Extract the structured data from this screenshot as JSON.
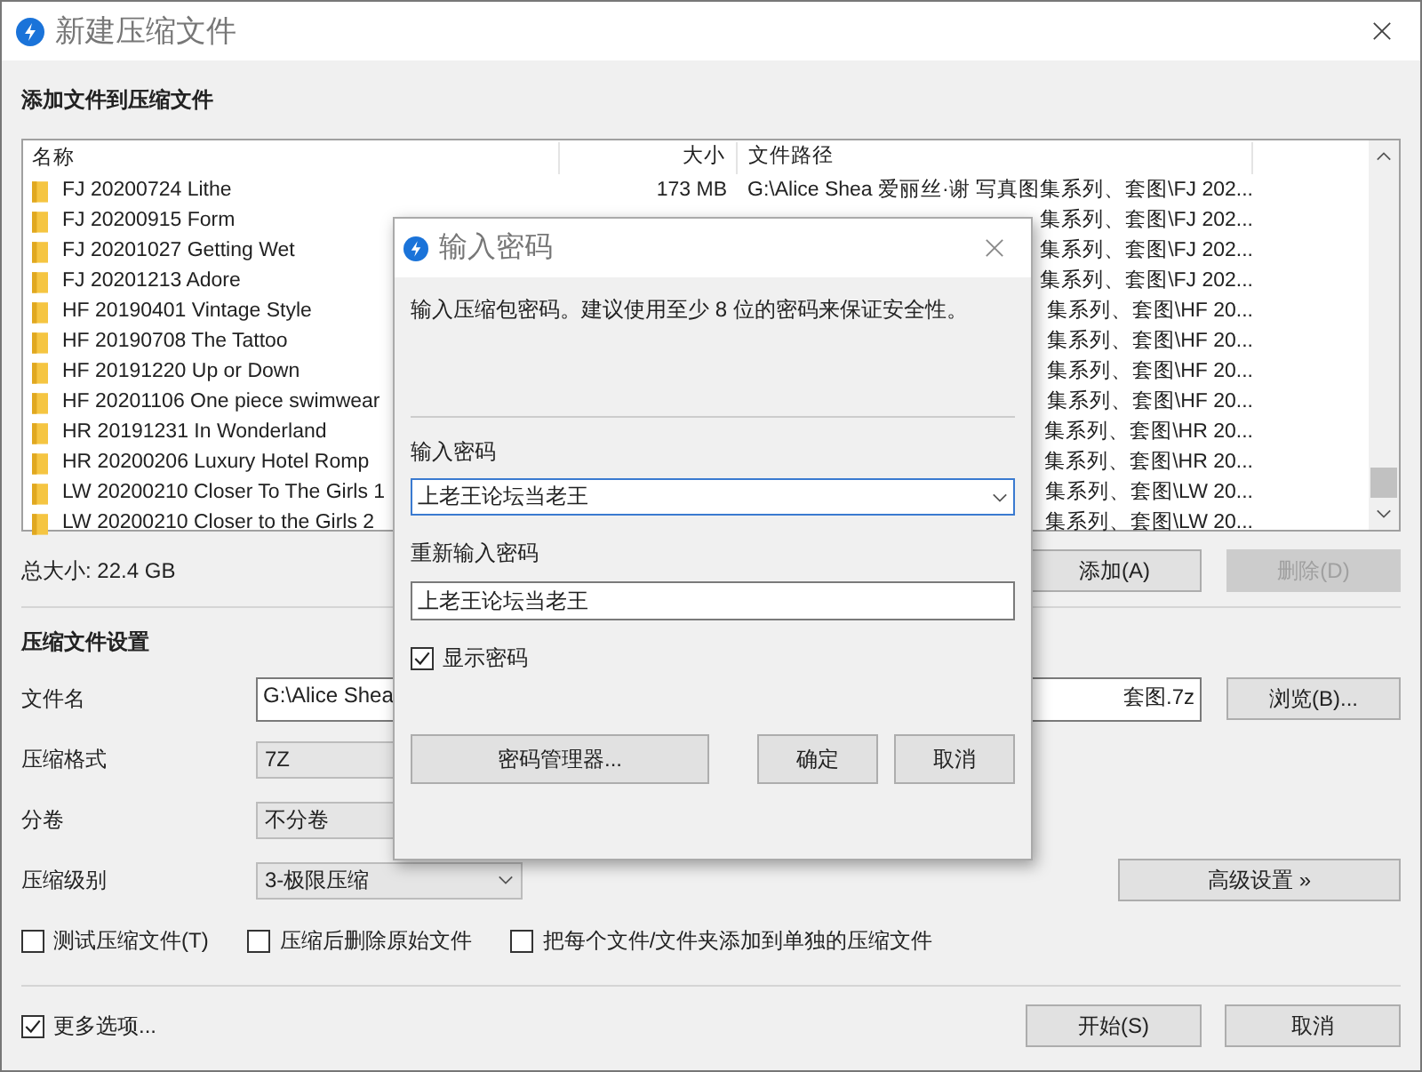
{
  "window": {
    "title": "新建压缩文件"
  },
  "add_section": {
    "heading": "添加文件到压缩文件",
    "columns": [
      "名称",
      "大小",
      "文件路径"
    ],
    "rows": [
      {
        "name": "FJ 20200724 Lithe",
        "size": "173 MB",
        "path": "G:\\Alice Shea 爱丽丝·谢 写真图集系列、套图\\FJ 202..."
      },
      {
        "name": "FJ 20200915 Form",
        "path": "集系列、套图\\FJ 202..."
      },
      {
        "name": "FJ 20201027 Getting Wet",
        "path": "集系列、套图\\FJ 202..."
      },
      {
        "name": "FJ 20201213 Adore",
        "path": "集系列、套图\\FJ 202..."
      },
      {
        "name": "HF 20190401 Vintage Style",
        "path": "集系列、套图\\HF 20..."
      },
      {
        "name": "HF 20190708 The Tattoo",
        "path": "集系列、套图\\HF 20..."
      },
      {
        "name": "HF 20191220 Up or Down",
        "path": "集系列、套图\\HF 20..."
      },
      {
        "name": "HF 20201106 One piece swimwear",
        "path": "集系列、套图\\HF 20..."
      },
      {
        "name": "HR 20191231 In Wonderland",
        "path": "集系列、套图\\HR 20..."
      },
      {
        "name": "HR 20200206 Luxury Hotel Romp",
        "path": "集系列、套图\\HR 20..."
      },
      {
        "name": "LW 20200210 Closer To The Girls 1",
        "path": "集系列、套图\\LW 20..."
      },
      {
        "name": "LW 20200210 Closer to the Girls 2",
        "path": "集系列、套图\\LW 20..."
      }
    ],
    "total": "总大小: 22.4 GB",
    "buttons": [
      {
        "label": "添加(A)",
        "disabled": false
      },
      {
        "label": "删除(D)",
        "disabled": true
      }
    ]
  },
  "settings": {
    "heading": "压缩文件设置",
    "filename": {
      "label": "文件名",
      "value_start": "G:\\Alice Shea",
      "value_end": "套图.7z",
      "button": "浏览(B)..."
    },
    "format": {
      "label": "压缩格式",
      "value": "7Z"
    },
    "volume": {
      "label": "分卷",
      "value": "不分卷"
    },
    "level": {
      "label": "压缩级别",
      "value": "3-极限压缩",
      "button": "高级设置 »"
    },
    "options": [
      {
        "label": "测试压缩文件(T)",
        "checked": false
      },
      {
        "label": "压缩后删除原始文件",
        "checked": false
      },
      {
        "label": "把每个文件/文件夹添加到单独的压缩文件",
        "checked": false
      }
    ]
  },
  "footer": {
    "more": {
      "label": "更多选项...",
      "checked": true
    },
    "buttons": [
      "开始(S)",
      "取消"
    ]
  },
  "dialog": {
    "title": "输入密码",
    "message": "输入压缩包密码。建议使用至少 8 位的密码来保证安全性。",
    "password_label": "输入密码",
    "password": "上老王论坛当老王",
    "repeat_label": "重新输入密码",
    "repeat": "上老王论坛当老王",
    "show": {
      "label": "显示密码",
      "checked": true
    },
    "manager": "密码管理器...",
    "ok": "确定",
    "cancel": "取消"
  }
}
